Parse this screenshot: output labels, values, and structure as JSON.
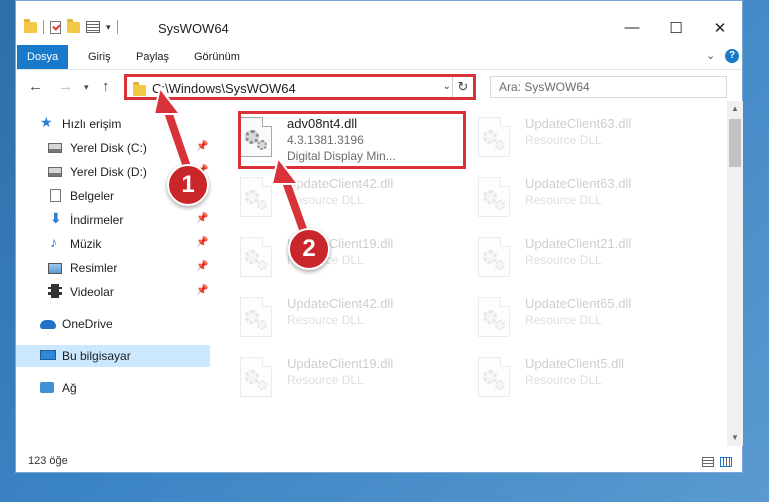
{
  "window": {
    "title": "SysWOW64",
    "minimize_icon": "minimize-icon",
    "maximize_icon": "maximize-icon",
    "close_icon": "close-icon"
  },
  "ribbon": {
    "tabs": [
      {
        "label": "Dosya",
        "active": true
      },
      {
        "label": "Giriş",
        "active": false
      },
      {
        "label": "Paylaş",
        "active": false
      },
      {
        "label": "Görünüm",
        "active": false
      }
    ]
  },
  "address": {
    "path": "C:\\Windows\\SysWOW64",
    "search_placeholder": "Ara: SysWOW64"
  },
  "sidebar": {
    "items": [
      {
        "label": "Hızlı erişim",
        "icon": "star-icon"
      },
      {
        "label": "Yerel Disk (C:)",
        "icon": "drive-icon",
        "pinned": true
      },
      {
        "label": "Yerel Disk (D:)",
        "icon": "drive-icon",
        "pinned": true
      },
      {
        "label": "Belgeler",
        "icon": "documents-icon",
        "pinned": true
      },
      {
        "label": "İndirmeler",
        "icon": "download-icon",
        "pinned": true
      },
      {
        "label": "Müzik",
        "icon": "music-icon",
        "pinned": true
      },
      {
        "label": "Resimler",
        "icon": "pictures-icon",
        "pinned": true
      },
      {
        "label": "Videolar",
        "icon": "videos-icon",
        "pinned": true
      },
      {
        "label": "OneDrive",
        "icon": "onedrive-icon"
      },
      {
        "label": "Bu bilgisayar",
        "icon": "computer-icon",
        "selected": true
      },
      {
        "label": "Ağ",
        "icon": "network-icon"
      }
    ]
  },
  "files": [
    {
      "name": "adv08nt4.dll",
      "line1": "4.3.1381.3196",
      "line2": "Digital Display Min...",
      "highlighted": true
    },
    {
      "name": "UpdateClient63.dll",
      "line1": "Resource DLL"
    },
    {
      "name": "UpdateClient42.dll",
      "line1": "Resource DLL"
    },
    {
      "name": "UpdateClient63.dll",
      "line1": "Resource DLL"
    },
    {
      "name": "UpdateClient19.dll",
      "line1": "Resource DLL"
    },
    {
      "name": "UpdateClient21.dll",
      "line1": "Resource DLL"
    },
    {
      "name": "UpdateClient42.dll",
      "line1": "Resource DLL"
    },
    {
      "name": "UpdateClient65.dll",
      "line1": "Resource DLL"
    },
    {
      "name": "UpdateClient19.dll",
      "line1": "Resource DLL"
    },
    {
      "name": "UpdateClient5.dll",
      "line1": "Resource DLL"
    }
  ],
  "status": {
    "item_count": "123 öğe"
  },
  "annotations": {
    "step1": "1",
    "step2": "2",
    "color": "#d9333a"
  }
}
